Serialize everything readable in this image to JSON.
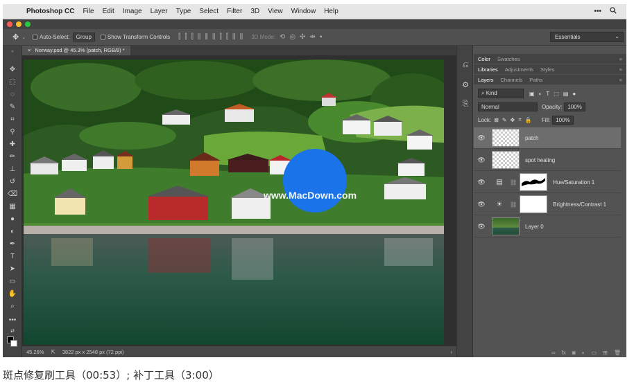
{
  "menubar": {
    "app_name": "Photoshop CC",
    "items": [
      "File",
      "Edit",
      "Image",
      "Layer",
      "Type",
      "Select",
      "Filter",
      "3D",
      "View",
      "Window",
      "Help"
    ],
    "icons": [
      "apple-icon",
      "more-icon",
      "search-icon"
    ]
  },
  "options": {
    "auto_select_label": "Auto-Select:",
    "auto_select_value": "Group",
    "show_transform_label": "Show Transform Controls",
    "mode_3d_label": "3D Mode:",
    "workspace": "Essentials"
  },
  "document": {
    "tab_title": "Norway.psd @ 45.3% (patch, RGB/8) *",
    "close_label": "×"
  },
  "status": {
    "zoom": "45.26%",
    "doc_info": "3822 px x 2548 px (72 ppi)"
  },
  "watermark": {
    "text": "www.MacDown.com"
  },
  "panels": {
    "top_tabs": [
      "Color",
      "Swatches"
    ],
    "mid_tabs": [
      "Libraries",
      "Adjustments",
      "Styles"
    ],
    "layer_tabs": [
      "Layers",
      "Channels",
      "Paths"
    ],
    "kind_label": "Kind",
    "blend_mode": "Normal",
    "opacity_label": "Opacity:",
    "opacity_value": "100%",
    "lock_label": "Lock:",
    "fill_label": "Fill:",
    "fill_value": "100%",
    "layers": [
      {
        "name": "patch",
        "selected": true
      },
      {
        "name": "spot healing",
        "selected": false
      },
      {
        "name": "Hue/Saturation 1",
        "selected": false
      },
      {
        "name": "Brightness/Contrast 1",
        "selected": false
      },
      {
        "name": "Layer 0",
        "selected": false
      }
    ],
    "footer_fx": "fx"
  },
  "colors": {
    "accent_blue": "#1a73e8",
    "ui_dark": "#535353",
    "fg_swatch": "#000000",
    "bg_swatch": "#ffffff"
  },
  "caption": "斑点修复刷工具（00:53）; 补丁工具（3:00）"
}
